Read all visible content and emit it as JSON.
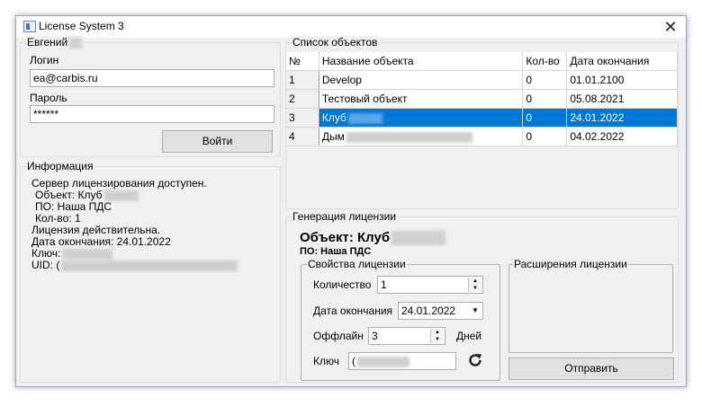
{
  "window": {
    "title": "License System 3",
    "close": "✕"
  },
  "login": {
    "group_title": "Евгений",
    "login_label": "Логин",
    "login_value": "ea@carbis.ru",
    "password_label": "Пароль",
    "password_value": "******",
    "submit_label": "Войти"
  },
  "info": {
    "group_title": "Информация",
    "line1": "Сервер лицензирования доступен.",
    "line2": "Объект: Клуб",
    "line3": "ПО: Наша ПДС",
    "line4": "Кол-во: 1",
    "line5": "Лицензия действительна.",
    "line6": "Дата окончания: 24.01.2022",
    "line7": "Ключ:",
    "line8": "UID: ("
  },
  "objects": {
    "group_title": "Список объектов",
    "columns": [
      "№",
      "Название объекта",
      "Кол-во",
      "Дата окончания"
    ],
    "rows": [
      {
        "n": "1",
        "name": "Develop",
        "qty": "0",
        "date": "01.01.2100"
      },
      {
        "n": "2",
        "name": "Тестовый объект",
        "qty": "0",
        "date": "05.08.2021"
      },
      {
        "n": "3",
        "name": "Клуб",
        "qty": "0",
        "date": "24.01.2022"
      },
      {
        "n": "4",
        "name": "Дым",
        "qty": "0",
        "date": "04.02.2022"
      }
    ],
    "selected_row": 3
  },
  "generation": {
    "group_title": "Генерация лицензии",
    "object_heading": "Объект: Клуб",
    "software_heading": "ПО: Наша ПДС",
    "props": {
      "group_title": "Свойства лицензии",
      "quantity_label": "Количество",
      "quantity_value": "1",
      "expiry_label": "Дата окончания",
      "expiry_value": "24.01.2022",
      "offline_label": "Оффлайн",
      "offline_value": "3",
      "offline_unit": "Дней",
      "key_label": "Ключ",
      "key_value": "("
    },
    "extensions_title": "Расширения лицензии",
    "send_label": "Отправить"
  },
  "colors": {
    "selection": "#0078d7",
    "window_bg": "#f0f0f0"
  }
}
